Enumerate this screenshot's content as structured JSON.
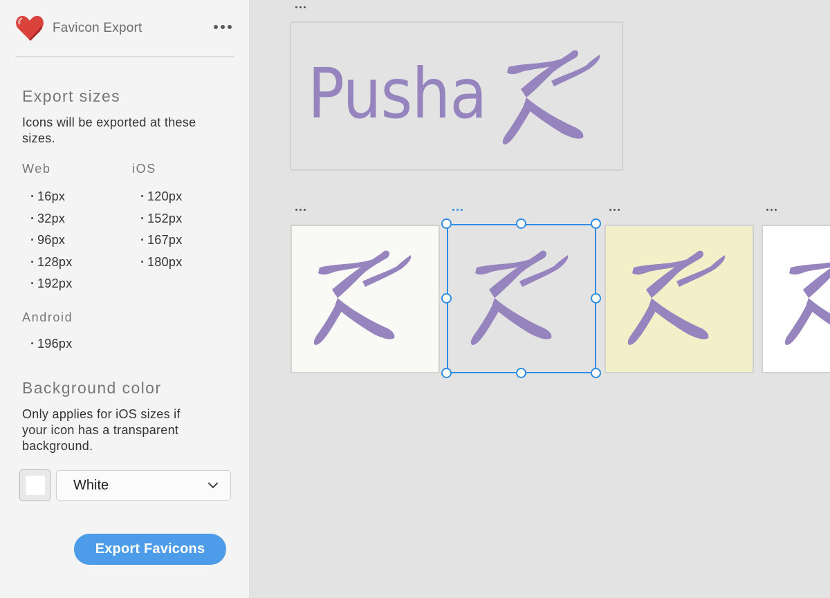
{
  "plugin": {
    "title": "Favicon Export",
    "icon": "heart-icon",
    "menu_icon": "more-horizontal-icon"
  },
  "export_sizes": {
    "title": "Export sizes",
    "description": "Icons will be exported at these sizes.",
    "groups": {
      "web": {
        "label": "Web",
        "sizes": [
          "16px",
          "32px",
          "96px",
          "128px",
          "192px"
        ]
      },
      "ios": {
        "label": "iOS",
        "sizes": [
          "120px",
          "152px",
          "167px",
          "180px"
        ]
      },
      "android": {
        "label": "Android",
        "sizes": [
          "196px"
        ]
      }
    }
  },
  "background_color": {
    "title": "Background color",
    "description": "Only applies for iOS sizes if your icon has a transparent background.",
    "swatch_color": "#ffffff",
    "selected": "White",
    "dropdown_icon": "chevron-down-icon"
  },
  "export_button": {
    "label": "Export Favicons"
  },
  "canvas": {
    "logo_text": "Pusha",
    "brand_color": "#9584bd",
    "selection_color": "#2f8de4",
    "icon_boards": [
      {
        "background": "#f9f9f6",
        "selected": false
      },
      {
        "background": "#e3e3e3",
        "selected": true
      },
      {
        "background": "#f2efc9",
        "selected": false
      },
      {
        "background": "#ffffff",
        "selected": false
      }
    ]
  },
  "accent_color": "#4d9cea"
}
